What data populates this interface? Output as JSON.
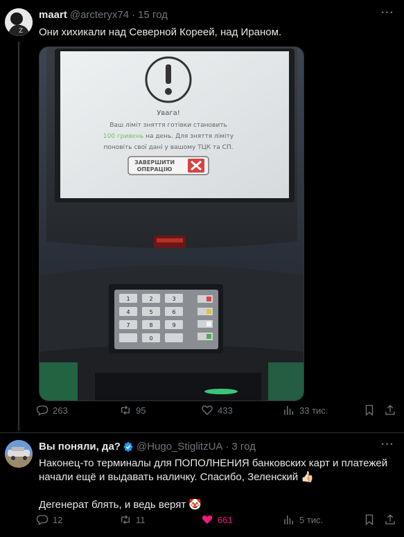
{
  "tweet1": {
    "display_name": "maart",
    "handle": "@arcteryx74",
    "separator": "·",
    "time": "15 год",
    "text": "Они хихикали над Северной Кореей, над Ираном.",
    "screen": {
      "title": "Увага!",
      "line1": "Ваш ліміт зняття готівки становить",
      "line2_amount": "100 гривень",
      "line2_rest": "на день. Для зняття ліміту",
      "line3": "поновіть свої дані у вашому ТЦК та СП.",
      "button_line1": "ЗАВЕРШИТИ",
      "button_line2": "ОПЕРАЦІЮ"
    },
    "keypad": [
      "1",
      "2",
      "3",
      "4",
      "5",
      "6",
      "7",
      "8",
      "9",
      "",
      "0",
      ""
    ],
    "stats": {
      "replies": "263",
      "reposts": "95",
      "likes": "433",
      "views": "33 тис."
    }
  },
  "tweet2": {
    "display_name": "Вы поняли, да?",
    "handle": "@Hugo_StiglitzUA",
    "separator": "·",
    "time": "3 год",
    "text_line1": "Наконец-то терминалы для ПОПОЛНЕНИЯ банковских карт и платежей",
    "text_line2": "начали ещё и выдавать наличку. Спасибо, Зеленский 👍🏻",
    "text_line3": "Дегенерат блять, и ведь верят 🤡",
    "stats": {
      "replies": "12",
      "reposts": "11",
      "likes": "661",
      "views": "5 тис."
    }
  },
  "colors": {
    "accent": "#1d9bf0",
    "like": "#f91880",
    "muted": "#71767b",
    "green_amount": "#6fbf73"
  }
}
